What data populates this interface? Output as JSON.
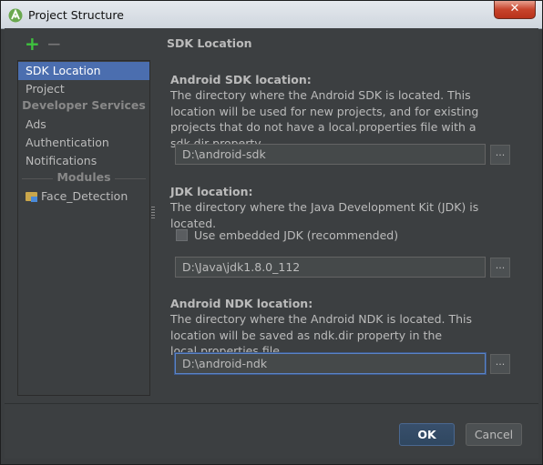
{
  "window": {
    "title": "Project Structure",
    "close_glyph": "✕"
  },
  "toolbar": {
    "add_glyph": "+",
    "remove_glyph": "−"
  },
  "sidebar": {
    "items": [
      {
        "label": "SDK Location",
        "selected": true
      },
      {
        "label": "Project"
      }
    ],
    "developer_services_header": "Developer Services",
    "developer_services": [
      {
        "label": "Ads"
      },
      {
        "label": "Authentication"
      },
      {
        "label": "Notifications"
      }
    ],
    "modules_header": "Modules",
    "modules": [
      {
        "label": "Face_Detection",
        "icon": "module-folder-icon"
      }
    ]
  },
  "panel": {
    "title": "SDK Location",
    "android_sdk": {
      "heading": "Android SDK location:",
      "description": "The directory where the Android SDK is located. This location will be used for new projects, and for existing projects that do not have a local.properties file with a sdk.dir property.",
      "value": "D:\\android-sdk"
    },
    "jdk": {
      "heading": "JDK location:",
      "description": "The directory where the Java Development Kit (JDK) is located.",
      "embedded_label": "Use embedded JDK (recommended)",
      "embedded_checked": false,
      "value": "D:\\Java\\jdk1.8.0_112"
    },
    "ndk": {
      "heading": "Android NDK location:",
      "description": "The directory where the Android NDK is located. This location will be saved as ndk.dir property in the local.properties file.",
      "value": "D:\\android-ndk"
    },
    "browse_label": "..."
  },
  "buttons": {
    "ok": "OK",
    "cancel": "Cancel"
  },
  "colors": {
    "background": "#3c3f41",
    "selection": "#4b6eaf",
    "add": "#3ec23e",
    "close": "#c7432b"
  }
}
